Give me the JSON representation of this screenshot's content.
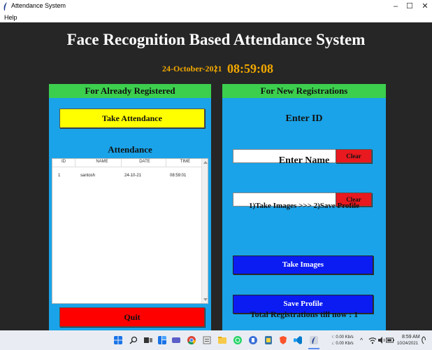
{
  "window": {
    "title": "Attendance System",
    "minimize_glyph": "–",
    "maximize_glyph": "☐",
    "close_glyph": "✕"
  },
  "menu": {
    "items": [
      "Help"
    ]
  },
  "header": {
    "title": "Face Recognition Based Attendance System",
    "date": "24-October-2021",
    "separator": "|",
    "time": "08:59:08"
  },
  "left_panel": {
    "heading": "For Already Registered",
    "take_attendance_label": "Take Attendance",
    "attendance_label": "Attendance",
    "table": {
      "columns": [
        "ID",
        "NAME",
        "DATE",
        "TIME"
      ],
      "rows": [
        [
          "1",
          "santosh",
          "24-10-21",
          "08:59:01"
        ]
      ]
    },
    "quit_label": "Quit"
  },
  "right_panel": {
    "heading": "For New Registrations",
    "enter_id_label": "Enter ID",
    "id_value": "",
    "clear_label": "Clear",
    "enter_name_label": "Enter Name",
    "name_value": "",
    "steps_text": "1)Take Images  >>>  2)Save Profile",
    "take_images_label": "Take Images",
    "save_profile_label": "Save Profile",
    "total_text": "Total Registrations till now  : 1"
  },
  "taskbar": {
    "net_up": "↑: 0.00 Kb/s",
    "net_down": "↓: 0.00 Kb/s",
    "tray_chevron": "^",
    "time": "8:59 AM",
    "date": "10/24/2021"
  },
  "colors": {
    "background": "#262626",
    "panel": "#1aa3e8",
    "panel_header": "#3ccf4e",
    "accent_yellow": "#ffff00",
    "accent_red": "#ff0000",
    "accent_blue": "#0a1cf2",
    "clock": "#f2a800"
  },
  "icons": [
    "feather-icon",
    "windows-start-icon",
    "search-icon",
    "task-view-icon",
    "widgets-icon",
    "teams-chat-icon",
    "chrome-icon",
    "file-explorer-icon",
    "folder-icon",
    "whatsapp-icon",
    "app-icon",
    "python-icon",
    "brave-icon",
    "vscode-icon",
    "feather-app-icon",
    "wifi-icon",
    "speaker-icon",
    "battery-icon",
    "notification-icon"
  ]
}
